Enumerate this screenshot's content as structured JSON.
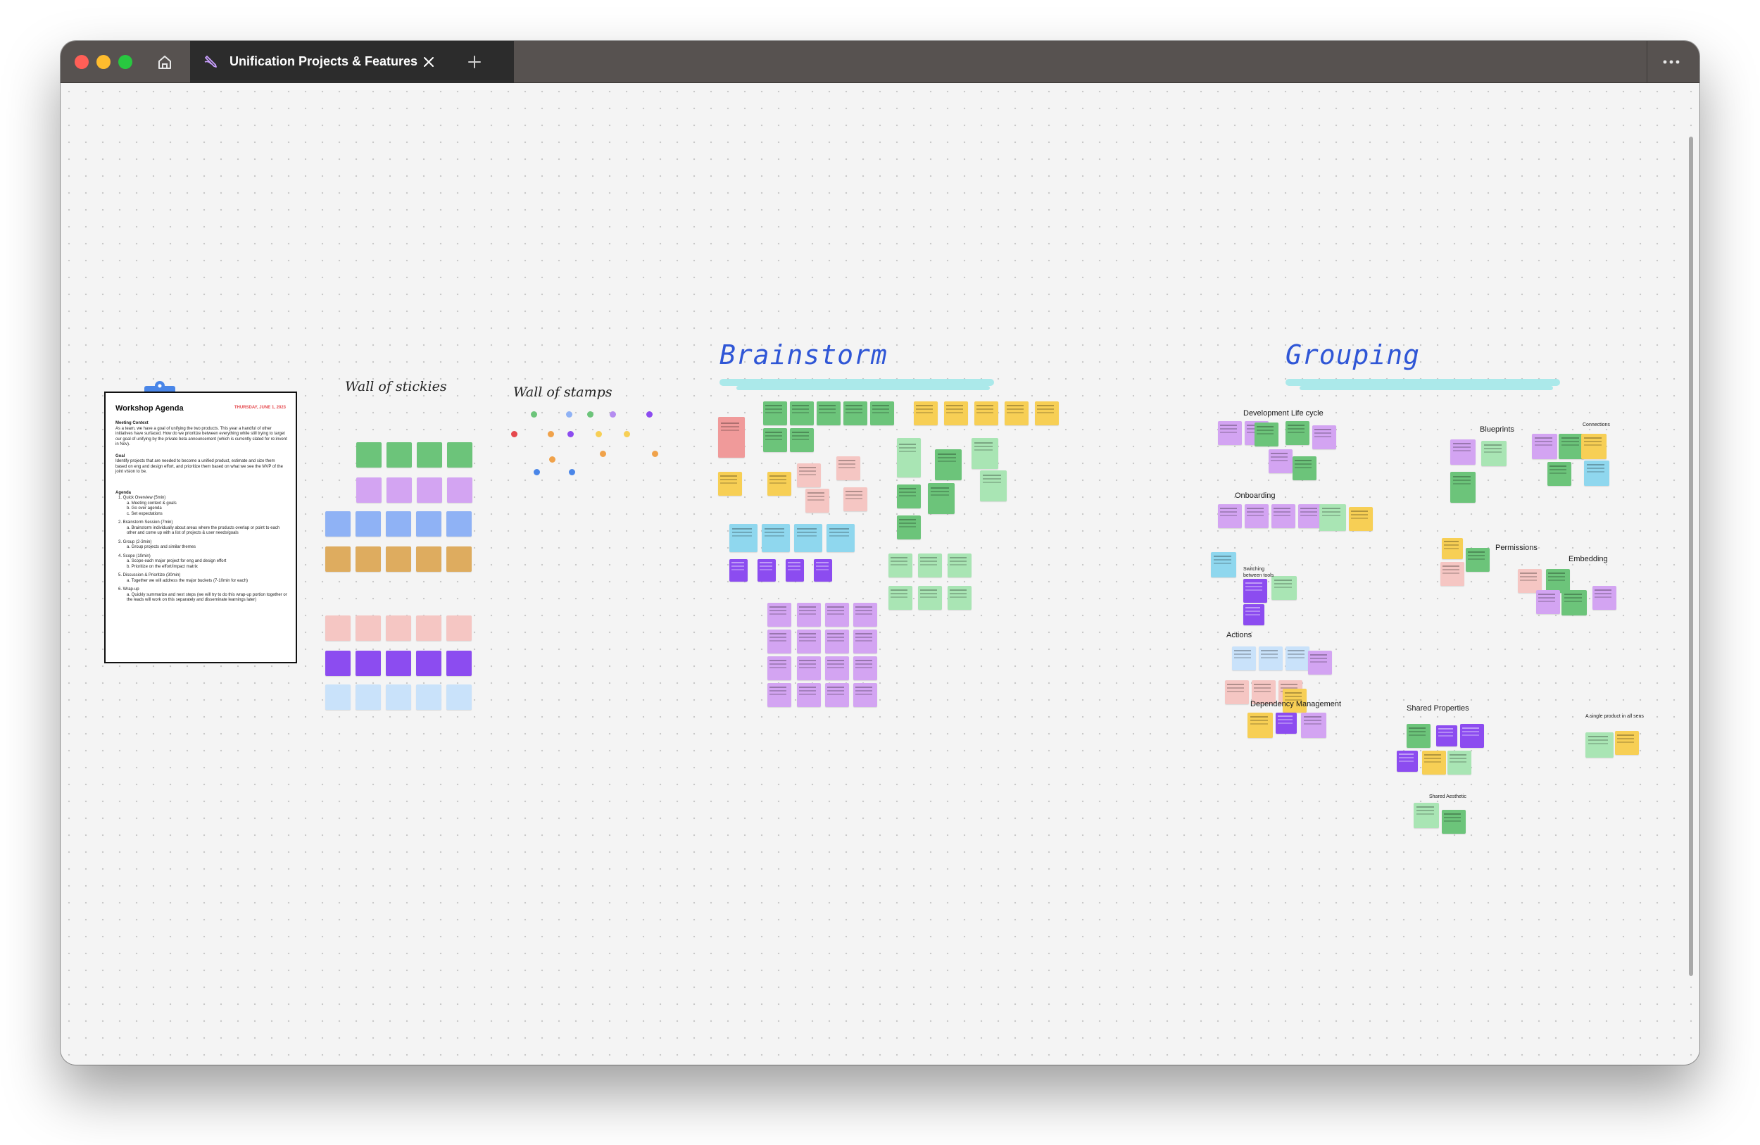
{
  "window": {
    "tab_title": "Unification Projects & Features: E",
    "icons": {
      "home": "home-icon",
      "tab": "figjam-pen-icon",
      "close": "close-icon",
      "new_tab": "plus-icon",
      "more": "more-horizontal-icon"
    }
  },
  "agenda": {
    "title": "Workshop Agenda",
    "date": "THURSDAY, JUNE 1, 2023",
    "context_heading": "Meeting Context",
    "context_text": "As a team, we have a goal of unifying the two products. This year a handful of other initiatives have surfaced. How do we prioritize between everything while still trying to target our goal of unifying by the private beta announcement (which is currently slated for re:invent in Nov).",
    "goal_heading": "Goal",
    "goal_text": "Identify projects that are needed to become a unified product, estimate and size them based on eng and design effort, and prioritize them based on what we see the MVP of the joint vision to be.",
    "agenda_heading": "Agenda",
    "items": [
      "1. Quick Overview (5min)",
      "a. Meeting context & goals",
      "b. Go over agenda",
      "c. Set expectations",
      "2. Brainstorm Session (7min)",
      "a. Brainstorm individually about areas where the products overlap or point to each other and come up with a list of projects & user needs/goals",
      "3. Group (2-3min)",
      "a. Group projects and similar themes",
      "4. Scope (10min)",
      "a. Scope each major project for eng and design effort",
      "b. Prioritize on the effort/impact matrix",
      "5. Discussion & Prioritize (30min)",
      "a. Together we will address the major buckets (7-10min for each)",
      "6. Wrap-up",
      "a. Quickly summarize and next steps (we will try to do this wrap-up portion together or the leads will work on this separately and disseminate learnings later)"
    ]
  },
  "labels": {
    "wall_of_stickies": "Wall of stickies",
    "wall_of_stamps": "Wall of stamps",
    "brainstorm": "Brainstorm",
    "grouping": "Grouping"
  },
  "groups": {
    "development_life_cycle": "Development Life cycle",
    "onboarding": "Onboarding",
    "switching_between_tools": "Switching between tools",
    "actions": "Actions",
    "dependency_management": "Dependency Management",
    "shared_properties": "Shared Properties",
    "shared_aesthetic": "Shared Aesthetic",
    "blueprints": "Blueprints",
    "connections": "Connections",
    "permissions": "Permissions",
    "embedding": "Embedding",
    "single_product": "A single product in all sens"
  },
  "colors": {
    "green": "#6cc47a",
    "light_green": "#a9e5b4",
    "violet": "#d3a4f2",
    "purple": "#8c4cf0",
    "blue": "#8fb2f5",
    "light_blue": "#c9e2fa",
    "orange": "#deac5f",
    "pink": "#f5c6c3",
    "yellow": "#f7cf55",
    "cyan": "#8fd7ee",
    "title_blue": "#2f56d6",
    "highlight": "#9de6e8",
    "agenda_date": "#e5484d"
  }
}
